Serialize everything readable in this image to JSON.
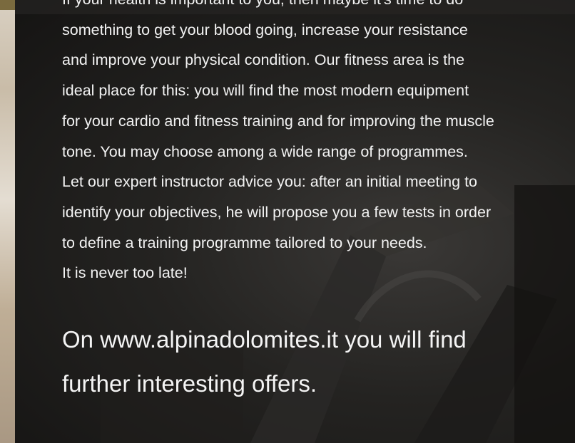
{
  "intro": {
    "lines": [
      "If your health is important to you, then maybe it's time to do",
      "something to get your blood going, increase your resistance",
      "and improve your physical condition. Our fitness area is the",
      "ideal place for this: you will find the most modern equipment",
      "for your cardio and fitness training and for improving the muscle",
      "tone. You may choose among a wide range of programmes.",
      "Let our expert instructor advice you: after an initial meeting to",
      "identify your objectives, he will propose you a few tests in order",
      "to define a training programme tailored to your needs.",
      "It is never too late!"
    ]
  },
  "offer": {
    "prefix": "On ",
    "link": "www.alpinadolomites.it",
    "suffix": " you will find",
    "line2": "further interesting offers."
  }
}
